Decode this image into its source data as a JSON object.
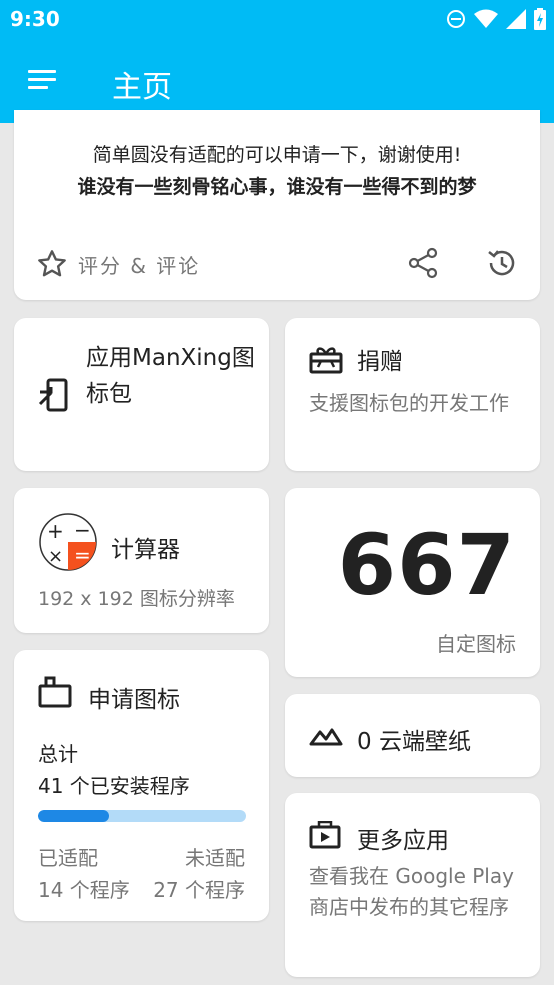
{
  "status_bar": {
    "time": "9:30",
    "icons": [
      "do-not-disturb-icon",
      "wifi-icon",
      "signal-icon",
      "battery-charging-icon"
    ]
  },
  "app_bar": {
    "title": "主页",
    "menu_icon": "menu-icon"
  },
  "intro_card": {
    "line1": "简单圆没有适配的可以申请一下，谢谢使用!",
    "line2": "谁没有一些刻骨铭心事，谁没有一些得不到的梦",
    "rate_label": "评分 & 评论",
    "icons": [
      "star-icon",
      "share-icon",
      "history-icon"
    ]
  },
  "apply_card": {
    "text": "应用ManXing图标包",
    "icon": "apply-icon"
  },
  "donate_card": {
    "title": "捐赠",
    "subtitle": "支援图标包的开发工作",
    "icon": "gift-icon"
  },
  "calculator_card": {
    "title": "计算器",
    "subtitle": "192 x 192 图标分辨率",
    "icon": "calculator-icon"
  },
  "count_card": {
    "count": "667",
    "label": "自定图标"
  },
  "request_card": {
    "title": "申请图标",
    "total_label": "总计",
    "total_value": "41 个已安装程序",
    "done_label": "已适配",
    "done_value": "14 个程序",
    "todo_label": "未适配",
    "todo_value": "27 个程序",
    "progress_fraction": 0.34
  },
  "wallpaper_card": {
    "title": "0 云端壁纸",
    "icon": "landscape-icon"
  },
  "more_apps_card": {
    "title": "更多应用",
    "subtitle": "查看我在 Google Play 商店中发布的其它程序",
    "icon": "play-store-icon"
  },
  "colors": {
    "primary": "#00bbf5",
    "progress_fill": "#1e88e5",
    "progress_track": "#b3dbf8",
    "calculator_accent": "#f4511e"
  }
}
